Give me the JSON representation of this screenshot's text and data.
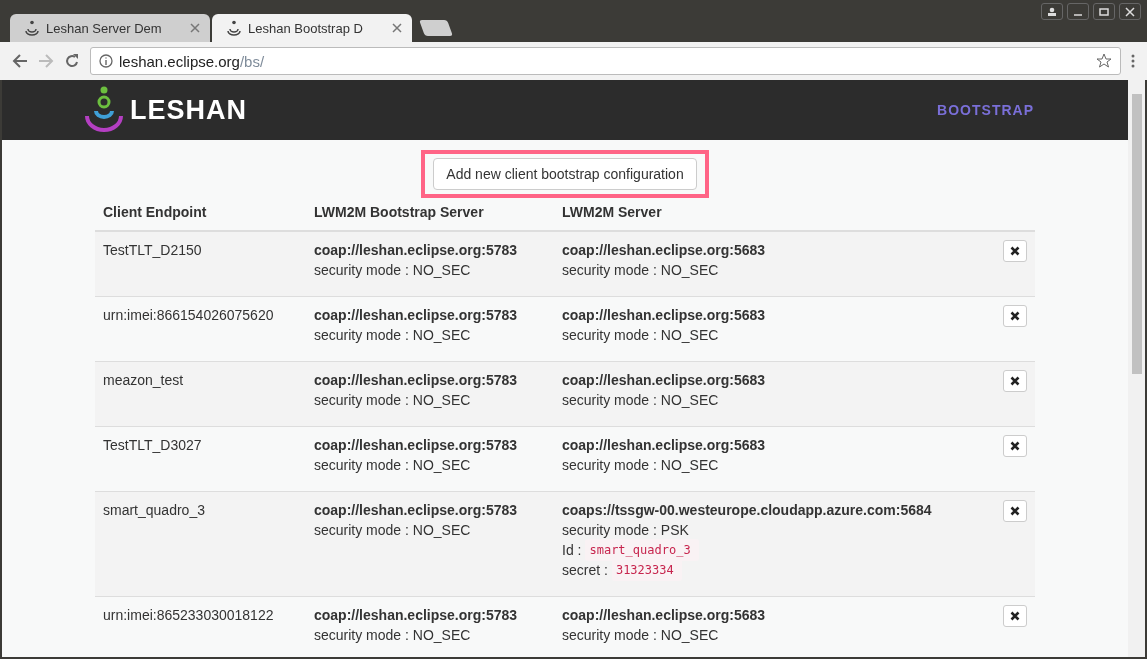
{
  "tabs": [
    {
      "label": "Leshan Server Dem",
      "selected": false
    },
    {
      "label": "Leshan Bootstrap D",
      "selected": true
    }
  ],
  "address": {
    "host": "leshan.eclipse.org",
    "path": "/bs/"
  },
  "header": {
    "logo": "LESHAN",
    "nav": "BOOTSTRAP"
  },
  "add_button": "Add new client bootstrap configuration",
  "table": {
    "columns": [
      "Client Endpoint",
      "LWM2M Bootstrap Server",
      "LWM2M Server"
    ],
    "rows": [
      {
        "endpoint": "TestTLT_D2150",
        "bs_uri": "coap://leshan.eclipse.org:5783",
        "bs_mode": "security mode : NO_SEC",
        "dm_uri": "coap://leshan.eclipse.org:5683",
        "dm_mode": "security mode : NO_SEC"
      },
      {
        "endpoint": "urn:imei:866154026075620",
        "bs_uri": "coap://leshan.eclipse.org:5783",
        "bs_mode": "security mode : NO_SEC",
        "dm_uri": "coap://leshan.eclipse.org:5683",
        "dm_mode": "security mode : NO_SEC"
      },
      {
        "endpoint": "meazon_test",
        "bs_uri": "coap://leshan.eclipse.org:5783",
        "bs_mode": "security mode : NO_SEC",
        "dm_uri": "coap://leshan.eclipse.org:5683",
        "dm_mode": "security mode : NO_SEC"
      },
      {
        "endpoint": "TestTLT_D3027",
        "bs_uri": "coap://leshan.eclipse.org:5783",
        "bs_mode": "security mode : NO_SEC",
        "dm_uri": "coap://leshan.eclipse.org:5683",
        "dm_mode": "security mode : NO_SEC"
      },
      {
        "endpoint": "smart_quadro_3",
        "bs_uri": "coap://leshan.eclipse.org:5783",
        "bs_mode": "security mode : NO_SEC",
        "dm_uri": "coaps://tssgw-00.westeurope.cloudapp.azure.com:5684",
        "dm_mode": "security mode : PSK",
        "credentials": [
          {
            "label": "Id :",
            "value": "smart_quadro_3"
          },
          {
            "label": "secret :",
            "value": "31323334"
          }
        ]
      },
      {
        "endpoint": "urn:imei:865233030018122",
        "bs_uri": "coap://leshan.eclipse.org:5783",
        "bs_mode": "security mode : NO_SEC",
        "dm_uri": "coap://leshan.eclipse.org:5683",
        "dm_mode": "security mode : NO_SEC"
      }
    ]
  }
}
